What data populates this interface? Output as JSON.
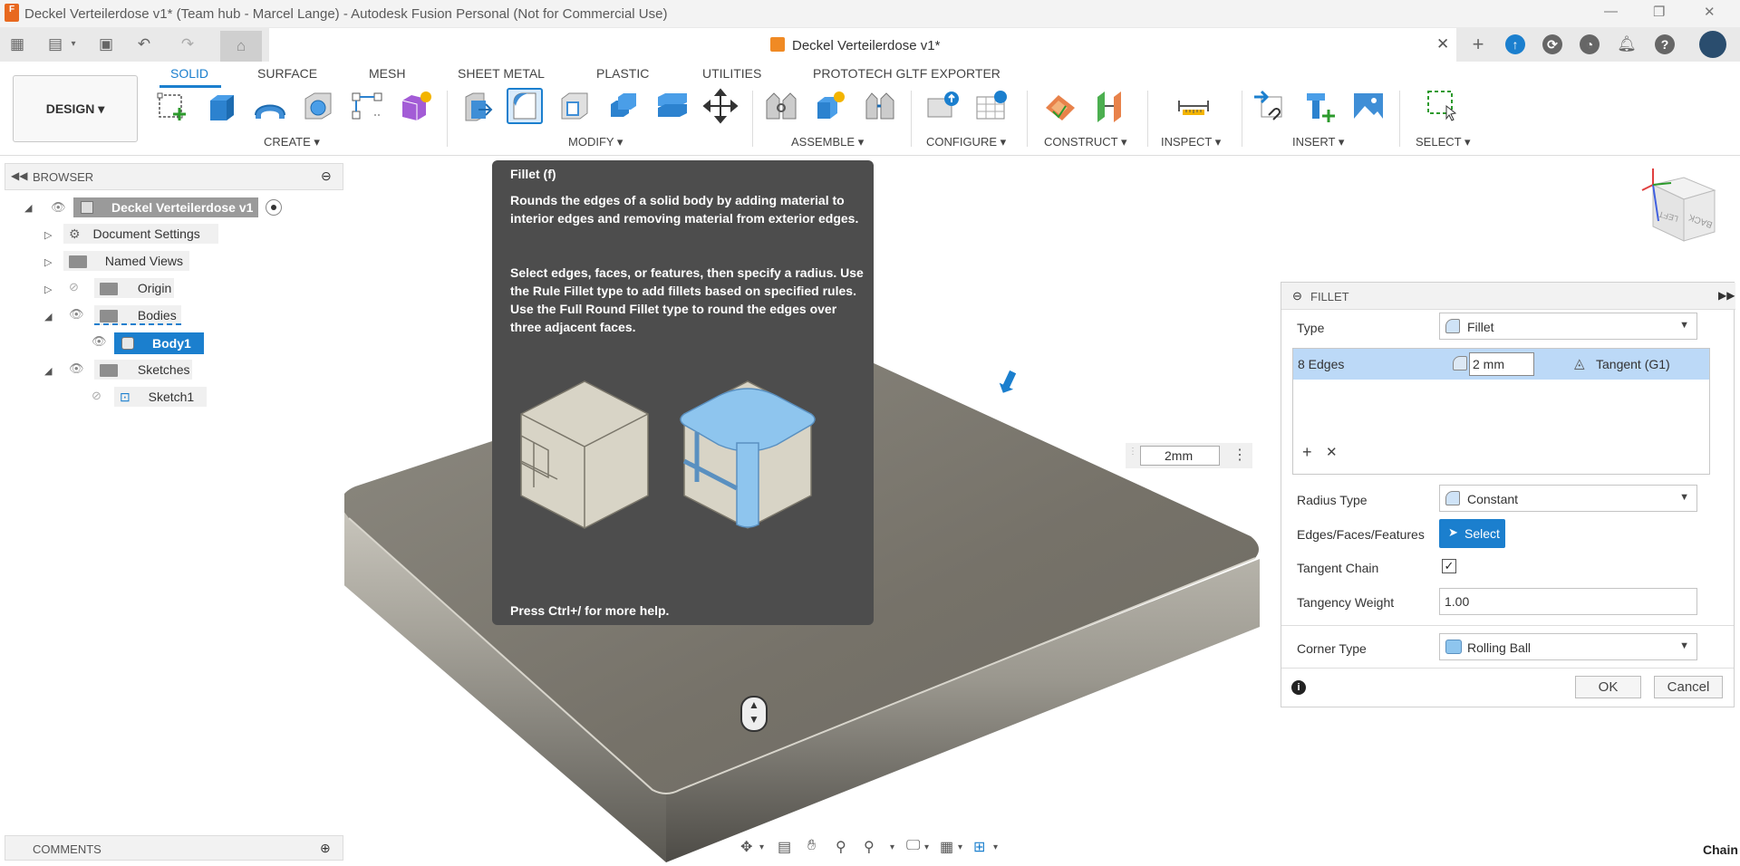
{
  "titlebar": {
    "title": "Deckel Verteilerdose v1* (Team hub - Marcel Lange) - Autodesk Fusion Personal (Not for Commercial Use)",
    "app_badge": "F"
  },
  "document_tab": {
    "title": "Deckel Verteilerdose v1*"
  },
  "workspace": {
    "label": "DESIGN ▾"
  },
  "tabs": [
    "SOLID",
    "SURFACE",
    "MESH",
    "SHEET METAL",
    "PLASTIC",
    "UTILITIES",
    "PROTOTECH GLTF EXPORTER"
  ],
  "groups": {
    "create": "CREATE ▾",
    "modify": "MODIFY ▾",
    "assemble": "ASSEMBLE ▾",
    "configure": "CONFIGURE ▾",
    "construct": "CONSTRUCT ▾",
    "inspect": "INSPECT ▾",
    "insert": "INSERT ▾",
    "select": "SELECT ▾"
  },
  "browser": {
    "title": "BROWSER",
    "root": "Deckel Verteilerdose v1",
    "items": [
      "Document Settings",
      "Named Views",
      "Origin",
      "Bodies",
      "Body1",
      "Sketches",
      "Sketch1"
    ]
  },
  "tooltip": {
    "title": "Fillet (f)",
    "p1": "Rounds the edges of a solid body by adding material to interior edges and removing material from exterior edges.",
    "p2": "Select edges, faces, or features, then specify a radius. Use the Rule Fillet type to add fillets based on specified rules. Use the Full Round Fillet type to round the edges over three adjacent faces.",
    "footer": "Press Ctrl+/ for more help."
  },
  "canvas_input": {
    "value": "2mm"
  },
  "fillet": {
    "header": "FILLET",
    "type_label": "Type",
    "type_value": "Fillet",
    "edges_label": "8 Edges",
    "radius_value": "2 mm",
    "continuity": "Tangent (G1)",
    "radius_type_label": "Radius Type",
    "radius_type_value": "Constant",
    "eff_label": "Edges/Faces/Features",
    "select_label": "Select",
    "tangent_chain_label": "Tangent Chain",
    "tangent_chain_checked": true,
    "tangency_weight_label": "Tangency Weight",
    "tangency_weight_value": "1.00",
    "corner_type_label": "Corner Type",
    "corner_type_value": "Rolling Ball",
    "ok_label": "OK",
    "cancel_label": "Cancel"
  },
  "viewcube": {
    "back": "BACK",
    "left": "LEFT"
  },
  "comments": {
    "label": "COMMENTS"
  },
  "status": {
    "chain": "Chain"
  },
  "colors": {
    "accent": "#1b7fce",
    "highlight_row": "#bcd9f7",
    "tooltip_bg": "#4d4d4d",
    "body": "#7d7a72"
  }
}
